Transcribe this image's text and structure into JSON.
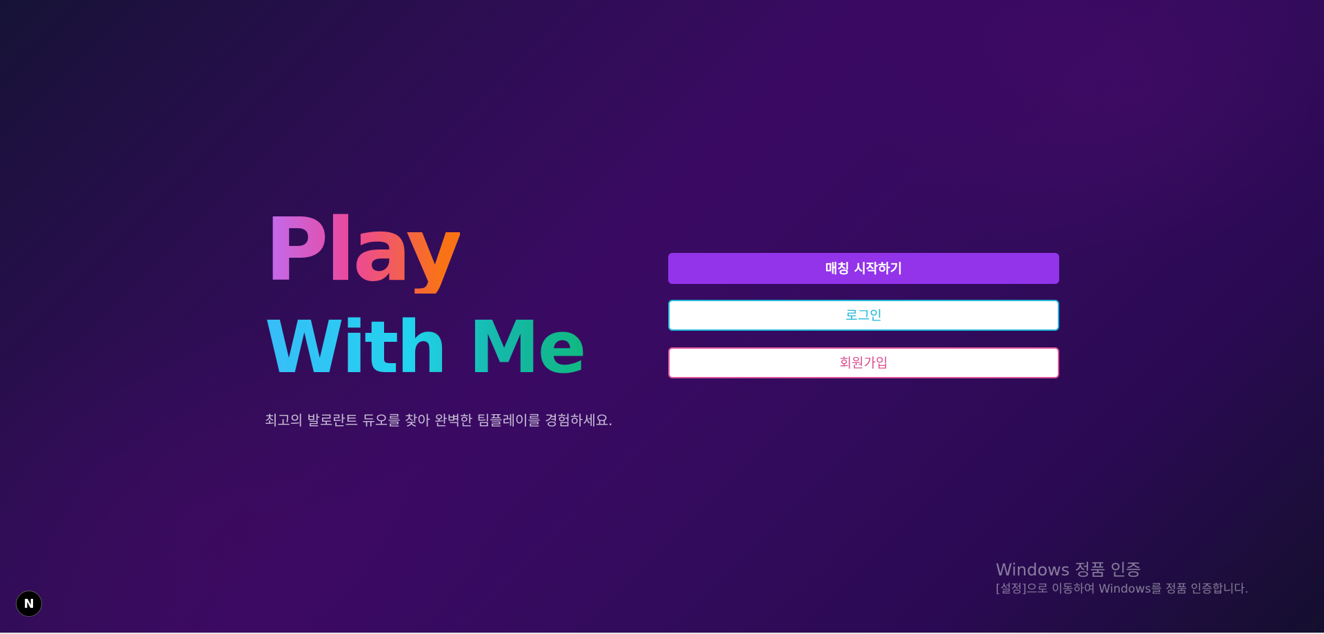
{
  "hero": {
    "title_line1": "Play",
    "title_line2": "With Me",
    "subtitle": "최고의 발로란트 듀오를 찾아 완벽한 팀플레이를 경험하세요."
  },
  "actions": {
    "start_matching": "매칭 시작하기",
    "login": "로그인",
    "signup": "회원가입"
  },
  "windows_activation": {
    "title": "Windows 정품 인증",
    "message": "[설정]으로 이동하여 Windows를 정품 인증합니다."
  },
  "dev_badge": {
    "label": "N",
    "icon": "nextjs-logo-icon"
  },
  "colors": {
    "background": "#2a0e4f",
    "primary_button": "#9333ea",
    "login_accent": "#22b8d8",
    "signup_accent": "#db4f91",
    "title_play_gradient": [
      "#c06cf0",
      "#ec4899",
      "#f97316"
    ],
    "title_with_gradient": [
      "#38bdf8",
      "#22d3ee",
      "#10b981"
    ]
  }
}
